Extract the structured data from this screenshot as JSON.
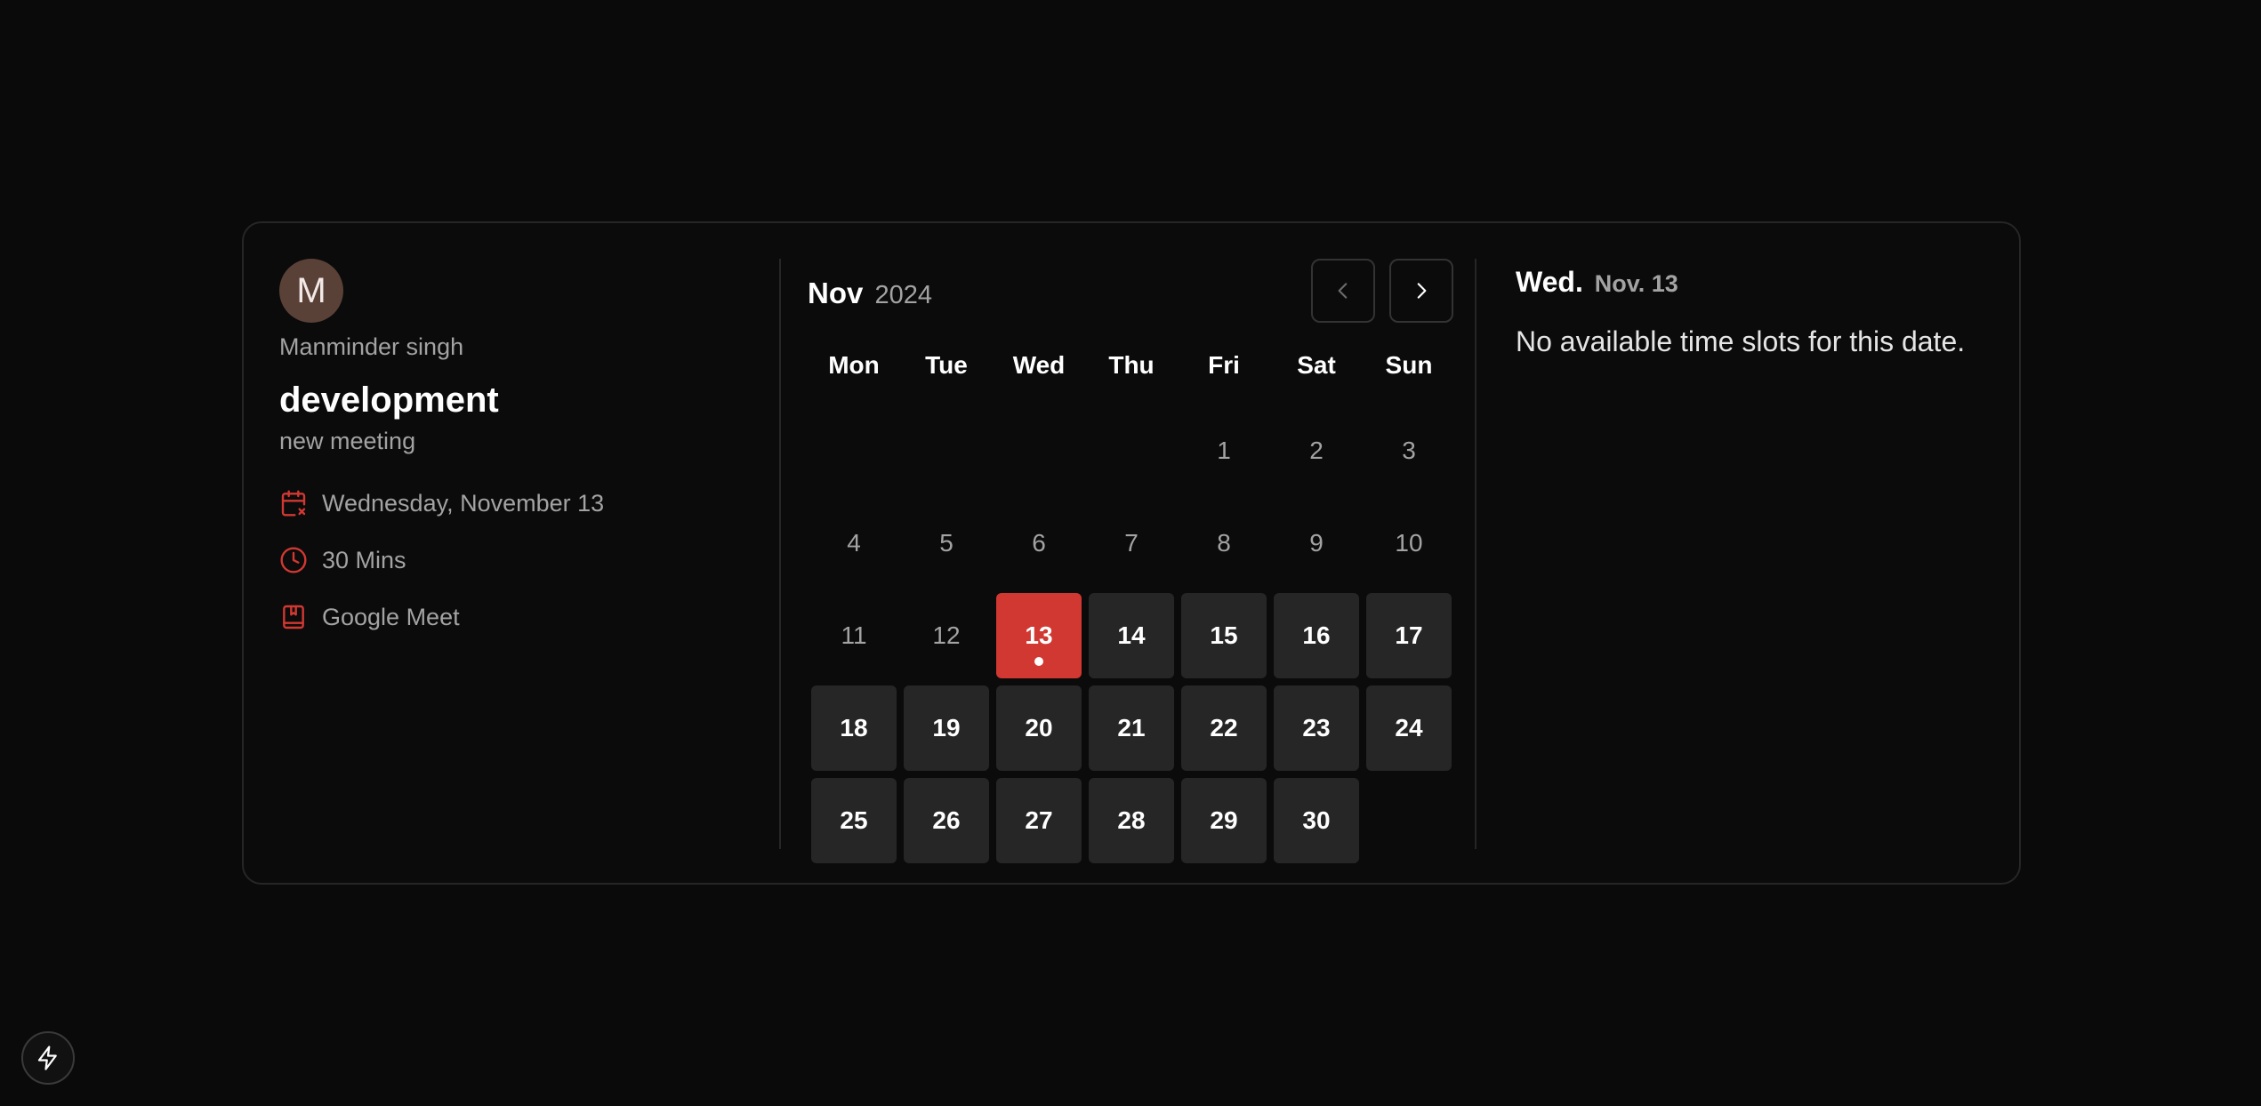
{
  "host": {
    "initial": "M",
    "name": "Manminder singh"
  },
  "event": {
    "title": "development",
    "description": "new meeting",
    "details": [
      {
        "icon": "calendar-x-icon",
        "text": "Wednesday, November 13"
      },
      {
        "icon": "clock-icon",
        "text": "30 Mins"
      },
      {
        "icon": "video-meeting-icon",
        "text": "Google Meet"
      }
    ]
  },
  "calendar": {
    "month": "Nov",
    "year": "2024",
    "weekdays": [
      "Mon",
      "Tue",
      "Wed",
      "Thu",
      "Fri",
      "Sat",
      "Sun"
    ],
    "leading_blanks": 4,
    "days": [
      {
        "label": "1",
        "state": "disabled"
      },
      {
        "label": "2",
        "state": "disabled"
      },
      {
        "label": "3",
        "state": "disabled"
      },
      {
        "label": "4",
        "state": "disabled"
      },
      {
        "label": "5",
        "state": "disabled"
      },
      {
        "label": "6",
        "state": "disabled"
      },
      {
        "label": "7",
        "state": "disabled"
      },
      {
        "label": "8",
        "state": "disabled"
      },
      {
        "label": "9",
        "state": "disabled"
      },
      {
        "label": "10",
        "state": "disabled"
      },
      {
        "label": "11",
        "state": "disabled"
      },
      {
        "label": "12",
        "state": "disabled"
      },
      {
        "label": "13",
        "state": "selected",
        "today_dot": true
      },
      {
        "label": "14",
        "state": "available"
      },
      {
        "label": "15",
        "state": "available"
      },
      {
        "label": "16",
        "state": "available"
      },
      {
        "label": "17",
        "state": "available"
      },
      {
        "label": "18",
        "state": "available"
      },
      {
        "label": "19",
        "state": "available"
      },
      {
        "label": "20",
        "state": "available"
      },
      {
        "label": "21",
        "state": "available"
      },
      {
        "label": "22",
        "state": "available"
      },
      {
        "label": "23",
        "state": "available"
      },
      {
        "label": "24",
        "state": "available"
      },
      {
        "label": "25",
        "state": "available"
      },
      {
        "label": "26",
        "state": "available"
      },
      {
        "label": "27",
        "state": "available"
      },
      {
        "label": "28",
        "state": "available"
      },
      {
        "label": "29",
        "state": "available"
      },
      {
        "label": "30",
        "state": "available"
      }
    ],
    "prev_icon": "chevron-left-icon",
    "next_icon": "chevron-right-icon"
  },
  "slots": {
    "day": "Wed.",
    "date": "Nov. 13",
    "empty_message": "No available time slots for this date."
  },
  "colors": {
    "accent": "#d13832",
    "background": "#0a0a0a",
    "day_tile": "#262626"
  },
  "corner_icon": "lightning-bolt-icon"
}
